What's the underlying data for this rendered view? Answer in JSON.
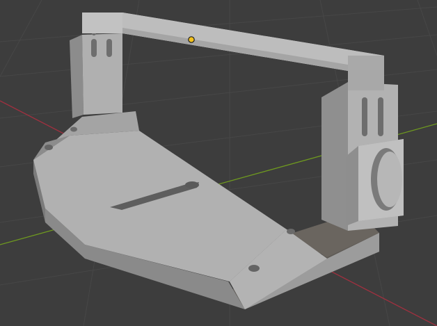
{
  "viewport": {
    "mode": "3d-viewport",
    "shading": "solid",
    "colors": {
      "background": "#3d3d3d",
      "grid_line": "#474747",
      "x_axis": "#a0303f",
      "y_axis": "#6f9a1f",
      "model_top": "#b4b4b4",
      "model_side": "#8f8f8f",
      "model_shadow": "#5e5a55",
      "origin_marker": "#f2c01c"
    }
  },
  "scene": {
    "object_icon": "3d-mount-bracket-icon",
    "origin_icon": "object-origin-icon"
  }
}
